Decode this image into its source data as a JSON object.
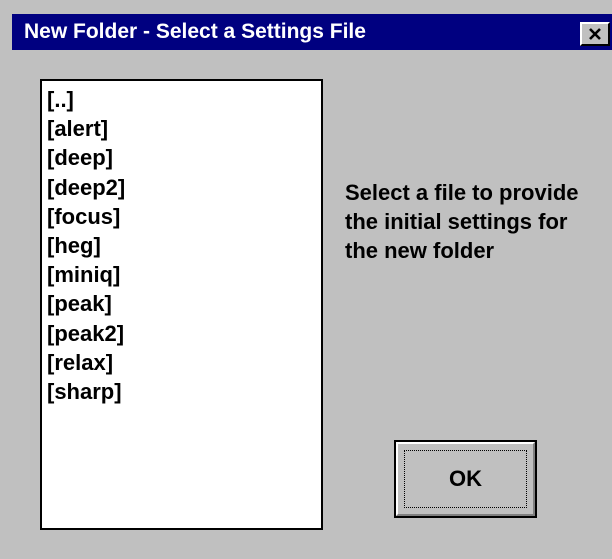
{
  "window": {
    "title": "New Folder - Select a Settings File",
    "close_icon": "close-x-icon"
  },
  "file_list": {
    "items": [
      "[..]",
      "[alert]",
      "[deep]",
      "[deep2]",
      "[focus]",
      "[heg]",
      "[miniq]",
      "[peak]",
      "[peak2]",
      "[relax]",
      "[sharp]"
    ]
  },
  "message": "Select a file to provide the initial settings for the new folder",
  "buttons": {
    "ok_label": "OK"
  },
  "colors": {
    "title_bar": "#000080",
    "window_background": "#c0c0c0",
    "list_background": "#ffffff"
  }
}
